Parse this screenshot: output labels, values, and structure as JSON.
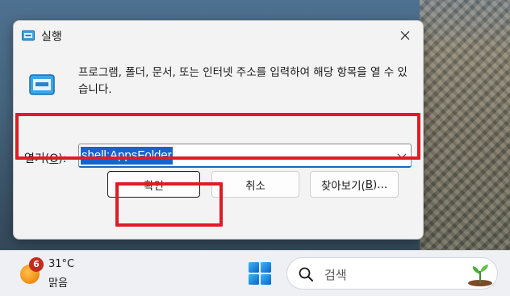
{
  "dialog": {
    "title": "실행",
    "description": "프로그램, 폴더, 문서, 또는 인터넷 주소를 입력하여 해당 항목을 열 수 있습니다.",
    "open_label_prefix": "열기(",
    "open_label_key": "O",
    "open_label_suffix": "):",
    "command_value": "shell:AppsFolder",
    "ok_label": "확인",
    "cancel_label": "취소",
    "browse_label_prefix": "찾아보기(",
    "browse_label_key": "B",
    "browse_label_suffix": ")...",
    "icons": {
      "title": "run-icon",
      "body": "run-icon",
      "close": "close-icon",
      "dropdown": "chevron-down-icon"
    }
  },
  "annotations": {
    "highlight_color": "#e01b24"
  },
  "taskbar": {
    "weather_badge": "6",
    "temperature": "31°C",
    "weather_condition": "맑음",
    "search_placeholder": "검색",
    "icons": {
      "weather": "sun-icon",
      "start": "windows-start-icon",
      "search": "search-icon",
      "search_highlight": "plant-icon"
    }
  }
}
